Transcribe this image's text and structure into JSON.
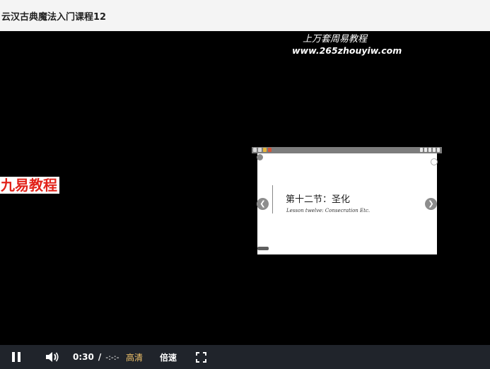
{
  "window": {
    "title": "云汉古典魔法入门课程12"
  },
  "watermark": {
    "line1": "上万套周易教程",
    "line2": "www.265zhouyiw.com",
    "left_label": "九易教程",
    "left_label_color": "#e2231a"
  },
  "slide": {
    "title": "第十二节：圣化",
    "subtitle": "Lesson twelve: Consecration Etc."
  },
  "controls": {
    "current_time": "0:30",
    "separator": "/",
    "duration": "-:-:-",
    "quality_label": "高清",
    "quality_color": "#f2c46b",
    "speed_label": "倍速",
    "icons": {
      "play": "pause-icon",
      "volume": "volume-icon",
      "fullscreen": "fullscreen-icon"
    }
  }
}
